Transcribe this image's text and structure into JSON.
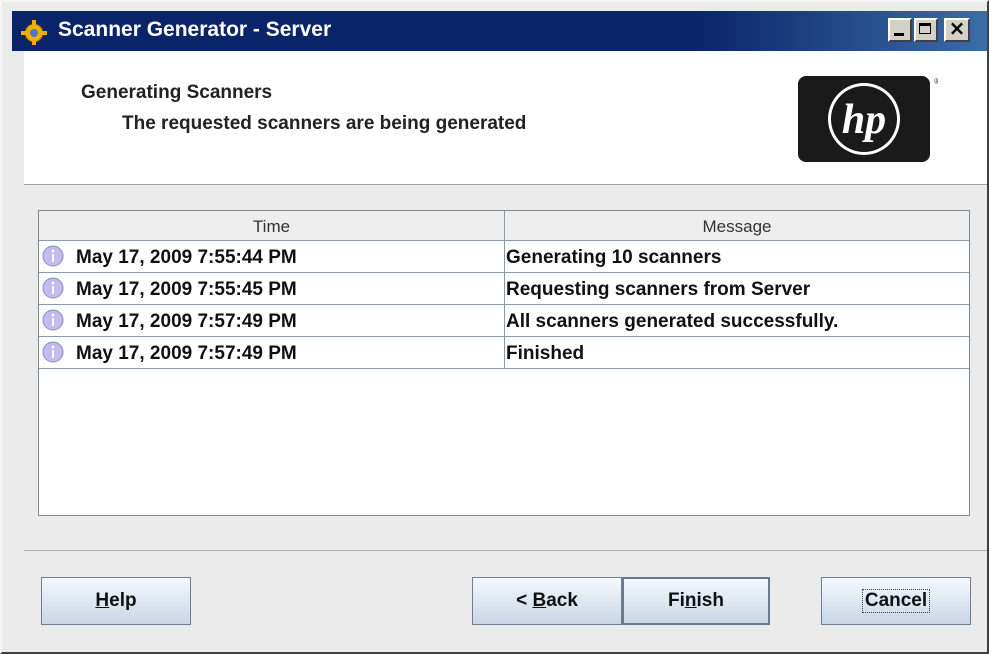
{
  "window": {
    "title": "Scanner Generator - Server"
  },
  "header": {
    "title": "Generating Scanners",
    "subtitle": "The requested scanners are being generated",
    "logo_text": "hp"
  },
  "table": {
    "columns": [
      "Time",
      "Message"
    ],
    "rows": [
      {
        "icon": "info-icon",
        "time": "May 17, 2009 7:55:44 PM",
        "message": "Generating 10 scanners"
      },
      {
        "icon": "info-icon",
        "time": "May 17, 2009 7:55:45 PM",
        "message": "Requesting scanners from Server"
      },
      {
        "icon": "info-icon",
        "time": "May 17, 2009 7:57:49 PM",
        "message": "All scanners generated successfully."
      },
      {
        "icon": "info-icon",
        "time": "May 17, 2009 7:57:49 PM",
        "message": "Finished"
      }
    ]
  },
  "buttons": {
    "help": {
      "pre": "",
      "mnemonic": "H",
      "post": "elp"
    },
    "back": {
      "pre": "< ",
      "mnemonic": "B",
      "post": "ack"
    },
    "finish": {
      "pre": "Fi",
      "mnemonic": "n",
      "post": "ish"
    },
    "cancel": {
      "label": "Cancel"
    }
  },
  "colors": {
    "titlebar": "#0a246a",
    "info_icon": "#b8b0e8",
    "button_gradient_top": "#f6f9fd",
    "button_gradient_bottom": "#c9d6e6"
  }
}
